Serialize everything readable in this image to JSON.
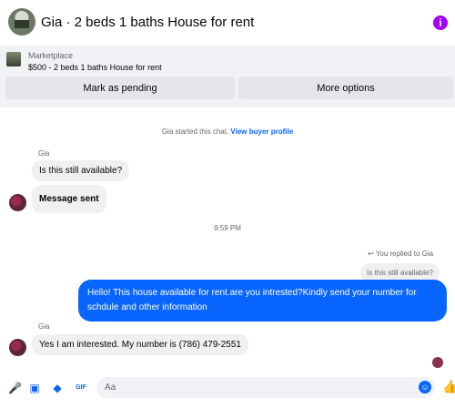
{
  "header": {
    "title": "Gia · 2 beds 1 baths House for rent",
    "info_icon": "i"
  },
  "marketplace": {
    "label": "Marketplace",
    "title": "$500 - 2 beds 1 baths House for rent"
  },
  "actions": {
    "pending": "Mark as pending",
    "more": "More options"
  },
  "chat": {
    "system": {
      "text": "Gia started this chat. ",
      "link": "View buyer profile"
    },
    "sender": "Gia",
    "messages": [
      {
        "text": "Is this still available?"
      },
      {
        "text": "Message sent"
      }
    ],
    "time": "9:59 PM",
    "reply_note": "You replied to Gia",
    "quote": "Is this still available?",
    "outgoing_lines": [
      "Hello! This house available for rent.are you intrested?Kindly send your number for",
      "schdule and other information"
    ],
    "last_sender": "Gia",
    "last_message": "Yes I am interested. My number is (786) 479-2551"
  },
  "composer": {
    "placeholder": "Aa"
  }
}
